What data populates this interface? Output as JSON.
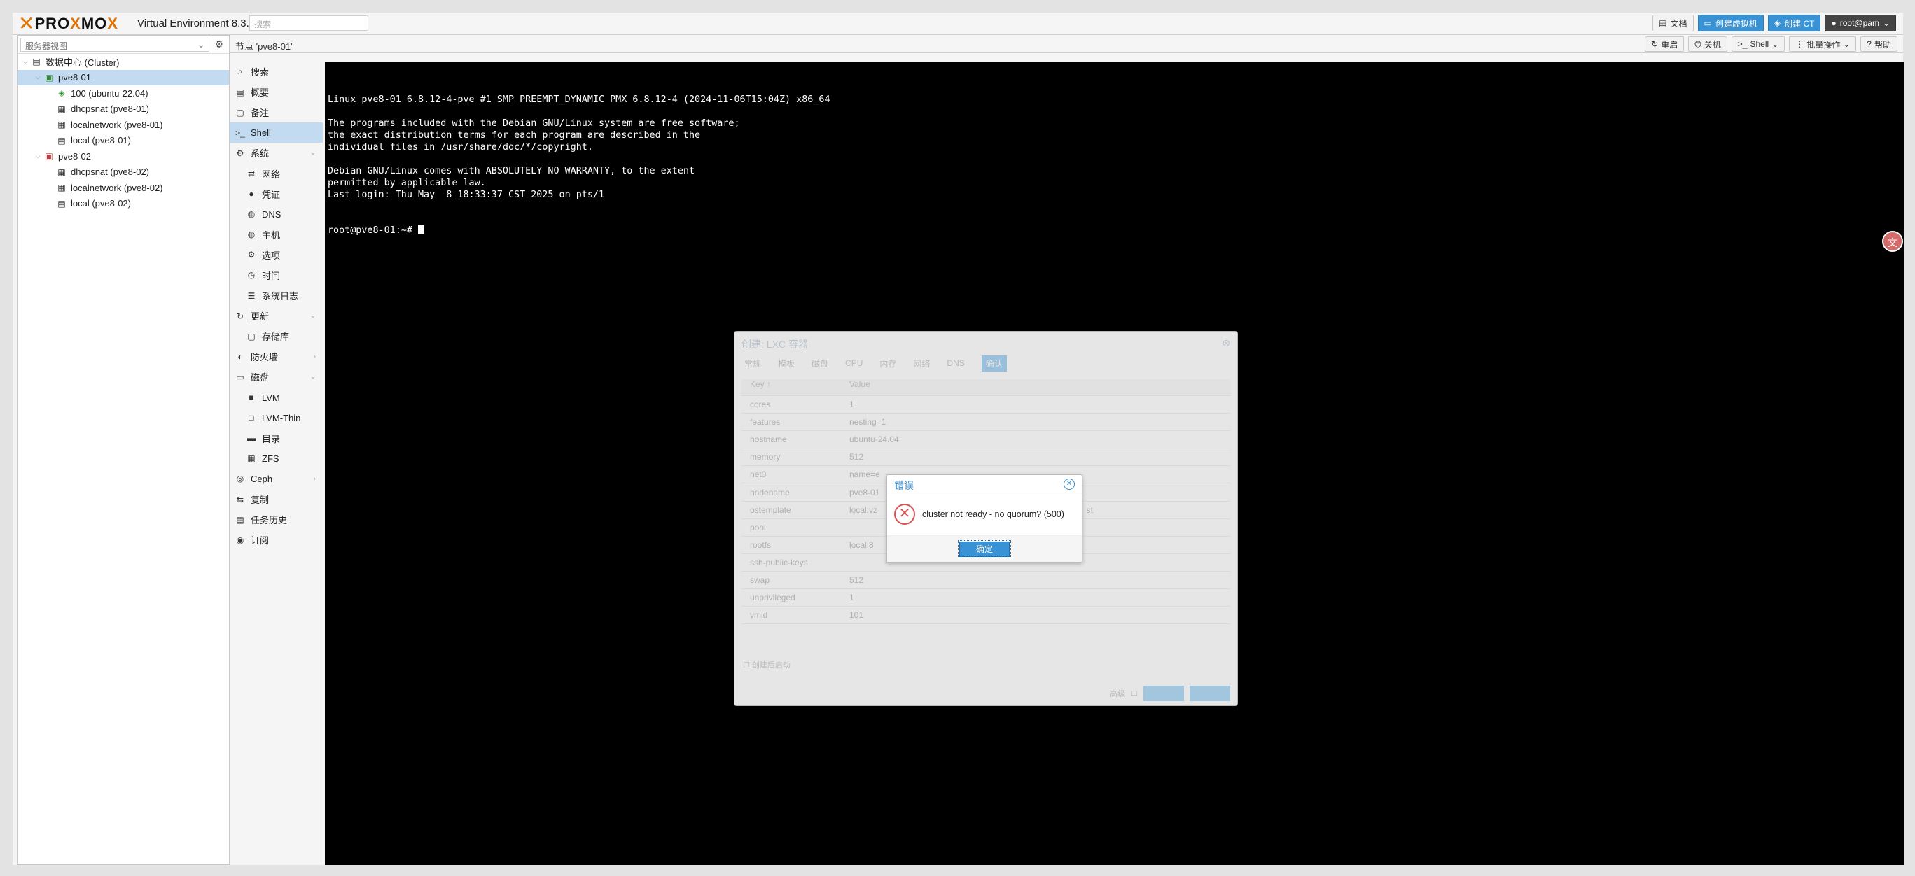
{
  "topbar": {
    "logo": "PROXMOX",
    "version": "Virtual Environment 8.3.0",
    "search_placeholder": "搜索",
    "buttons": {
      "docs": "文档",
      "create_vm": "创建虚拟机",
      "create_ct": "创建 CT",
      "user": "root@pam"
    }
  },
  "tree": {
    "view": "服务器视图",
    "rows": [
      {
        "label": "数据中心 (Cluster)",
        "depth": 0,
        "icon": "datacenter-icon",
        "exp": "⌵"
      },
      {
        "label": "pve8-01",
        "depth": 1,
        "icon": "node-online-icon",
        "exp": "⌵",
        "selected": true
      },
      {
        "label": "100 (ubuntu-22.04)",
        "depth": 2,
        "icon": "container-icon",
        "exp": ""
      },
      {
        "label": "dhcpsnat (pve8-01)",
        "depth": 2,
        "icon": "sdn-zone-icon",
        "exp": ""
      },
      {
        "label": "localnetwork (pve8-01)",
        "depth": 2,
        "icon": "sdn-zone-icon",
        "exp": ""
      },
      {
        "label": "local (pve8-01)",
        "depth": 2,
        "icon": "storage-icon",
        "exp": ""
      },
      {
        "label": "pve8-02",
        "depth": 1,
        "icon": "node-offline-icon",
        "exp": "⌵"
      },
      {
        "label": "dhcpsnat (pve8-02)",
        "depth": 2,
        "icon": "sdn-zone-icon",
        "exp": ""
      },
      {
        "label": "localnetwork (pve8-02)",
        "depth": 2,
        "icon": "sdn-zone-icon",
        "exp": ""
      },
      {
        "label": "local (pve8-02)",
        "depth": 2,
        "icon": "storage-icon",
        "exp": ""
      }
    ]
  },
  "node_header": {
    "title": "节点 'pve8-01'",
    "buttons": {
      "reboot": "重启",
      "shutdown": "关机",
      "shell": "Shell",
      "bulk": "批量操作",
      "help": "帮助"
    }
  },
  "menu": [
    {
      "label": "搜索",
      "icon": "search-icon",
      "sub": false
    },
    {
      "label": "概要",
      "icon": "book-icon",
      "sub": false
    },
    {
      "label": "备注",
      "icon": "notes-icon",
      "sub": false
    },
    {
      "label": "Shell",
      "icon": "terminal-icon",
      "sub": false,
      "selected": true
    },
    {
      "label": "系统",
      "icon": "cogs-icon",
      "sub": false,
      "arrow": "⌄"
    },
    {
      "label": "网络",
      "icon": "exchange-icon",
      "sub": true
    },
    {
      "label": "凭证",
      "icon": "certificate-icon",
      "sub": true
    },
    {
      "label": "DNS",
      "icon": "globe-icon",
      "sub": true
    },
    {
      "label": "主机",
      "icon": "globe-icon",
      "sub": true
    },
    {
      "label": "选项",
      "icon": "gear-icon",
      "sub": true
    },
    {
      "label": "时间",
      "icon": "clock-icon",
      "sub": true
    },
    {
      "label": "系统日志",
      "icon": "list-icon",
      "sub": true
    },
    {
      "label": "更新",
      "icon": "refresh-icon",
      "sub": false,
      "arrow": "⌄"
    },
    {
      "label": "存储库",
      "icon": "repository-icon",
      "sub": true
    },
    {
      "label": "防火墙",
      "icon": "shield-icon",
      "sub": false,
      "arrow": "›"
    },
    {
      "label": "磁盘",
      "icon": "hdd-icon",
      "sub": false,
      "arrow": "⌄"
    },
    {
      "label": "LVM",
      "icon": "square-icon",
      "sub": true
    },
    {
      "label": "LVM-Thin",
      "icon": "square-outline-icon",
      "sub": true
    },
    {
      "label": "目录",
      "icon": "folder-icon",
      "sub": true
    },
    {
      "label": "ZFS",
      "icon": "th-large-icon",
      "sub": true
    },
    {
      "label": "Ceph",
      "icon": "ceph-icon",
      "sub": false,
      "arrow": "›"
    },
    {
      "label": "复制",
      "icon": "retweet-icon",
      "sub": false
    },
    {
      "label": "任务历史",
      "icon": "list-alt-icon",
      "sub": false
    },
    {
      "label": "订阅",
      "icon": "support-icon",
      "sub": false
    }
  ],
  "terminal": {
    "lines": [
      "Linux pve8-01 6.8.12-4-pve #1 SMP PREEMPT_DYNAMIC PMX 6.8.12-4 (2024-11-06T15:04Z) x86_64",
      "",
      "The programs included with the Debian GNU/Linux system are free software;",
      "the exact distribution terms for each program are described in the",
      "individual files in /usr/share/doc/*/copyright.",
      "",
      "Debian GNU/Linux comes with ABSOLUTELY NO WARRANTY, to the extent",
      "permitted by applicable law.",
      "Last login: Thu May  8 18:33:37 CST 2025 on pts/1"
    ],
    "prompt": "root@pve8-01:~# "
  },
  "lxc_dialog": {
    "title": "创建: LXC 容器",
    "tabs": [
      "常规",
      "模板",
      "磁盘",
      "CPU",
      "内存",
      "网络",
      "DNS",
      "确认"
    ],
    "active_tab": "确认",
    "col_key": "Key ↑",
    "col_value": "Value",
    "rows": [
      {
        "k": "cores",
        "v": "1"
      },
      {
        "k": "features",
        "v": "nesting=1"
      },
      {
        "k": "hostname",
        "v": "ubuntu-24.04"
      },
      {
        "k": "memory",
        "v": "512"
      },
      {
        "k": "net0",
        "v": "name=e"
      },
      {
        "k": "nodename",
        "v": "pve8-01"
      },
      {
        "k": "ostemplate",
        "v": "local:vz"
      },
      {
        "k": "pool",
        "v": ""
      },
      {
        "k": "rootfs",
        "v": "local:8"
      },
      {
        "k": "ssh-public-keys",
        "v": ""
      },
      {
        "k": "swap",
        "v": "512"
      },
      {
        "k": "unprivileged",
        "v": "1"
      },
      {
        "k": "vmid",
        "v": "101"
      }
    ],
    "ostemplate_tail": "st",
    "advanced": "创建后启动",
    "advanced_label": "高级",
    "back": "上一步",
    "finish": "完成"
  },
  "error_dialog": {
    "title": "错误",
    "message": "cluster not ready - no quorum? (500)",
    "ok": "确定"
  }
}
